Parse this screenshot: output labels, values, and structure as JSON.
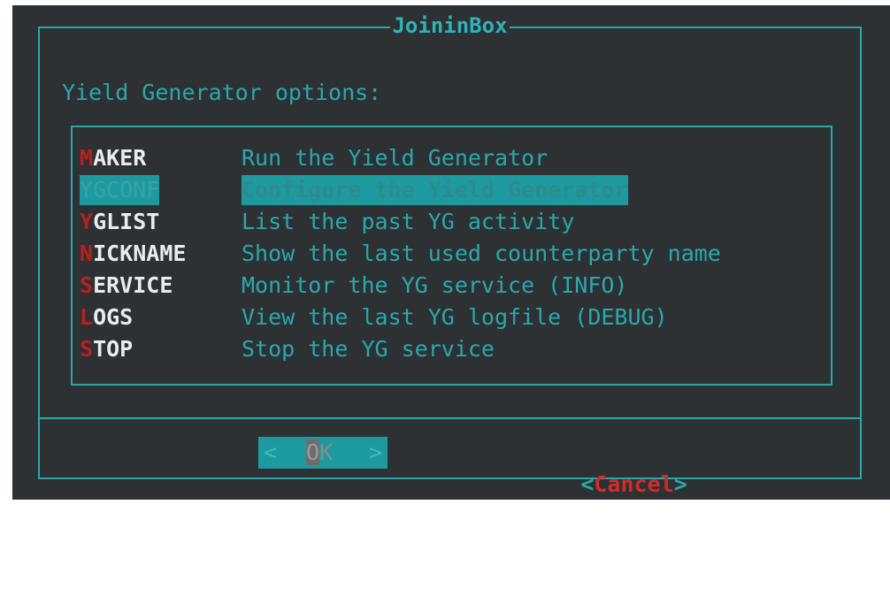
{
  "dialog": {
    "title": "JoininBox",
    "prompt": "Yield Generator options:"
  },
  "menu": {
    "items": [
      {
        "hotkey": "M",
        "rest": "AKER",
        "description": "Run the Yield Generator",
        "selected": false
      },
      {
        "hotkey": "Y",
        "rest": "GCONF",
        "description": "Configure the Yield Generator",
        "selected": true
      },
      {
        "hotkey": "Y",
        "rest": "GLIST",
        "description": "List the past YG activity",
        "selected": false
      },
      {
        "hotkey": "N",
        "rest": "ICKNAME",
        "description": "Show the last used counterparty name",
        "selected": false
      },
      {
        "hotkey": "S",
        "rest": "ERVICE",
        "description": "Monitor the YG service (INFO)",
        "selected": false
      },
      {
        "hotkey": "L",
        "rest": "OGS",
        "description": "View the last YG logfile (DEBUG)",
        "selected": false
      },
      {
        "hotkey": "S",
        "rest": "TOP",
        "description": "Stop the YG service",
        "selected": false
      }
    ]
  },
  "buttons": {
    "ok": {
      "left": "<",
      "cursor": "O",
      "label": "K",
      "right": ">"
    },
    "cancel": {
      "open": "<",
      "label": "Cancel",
      "close": ">"
    }
  },
  "colors": {
    "background": "#2d3133",
    "accent": "#2aa8ad",
    "selection": "#1d9aa0",
    "hotkey": "#b8201f",
    "cancel": "#d42a2a"
  }
}
